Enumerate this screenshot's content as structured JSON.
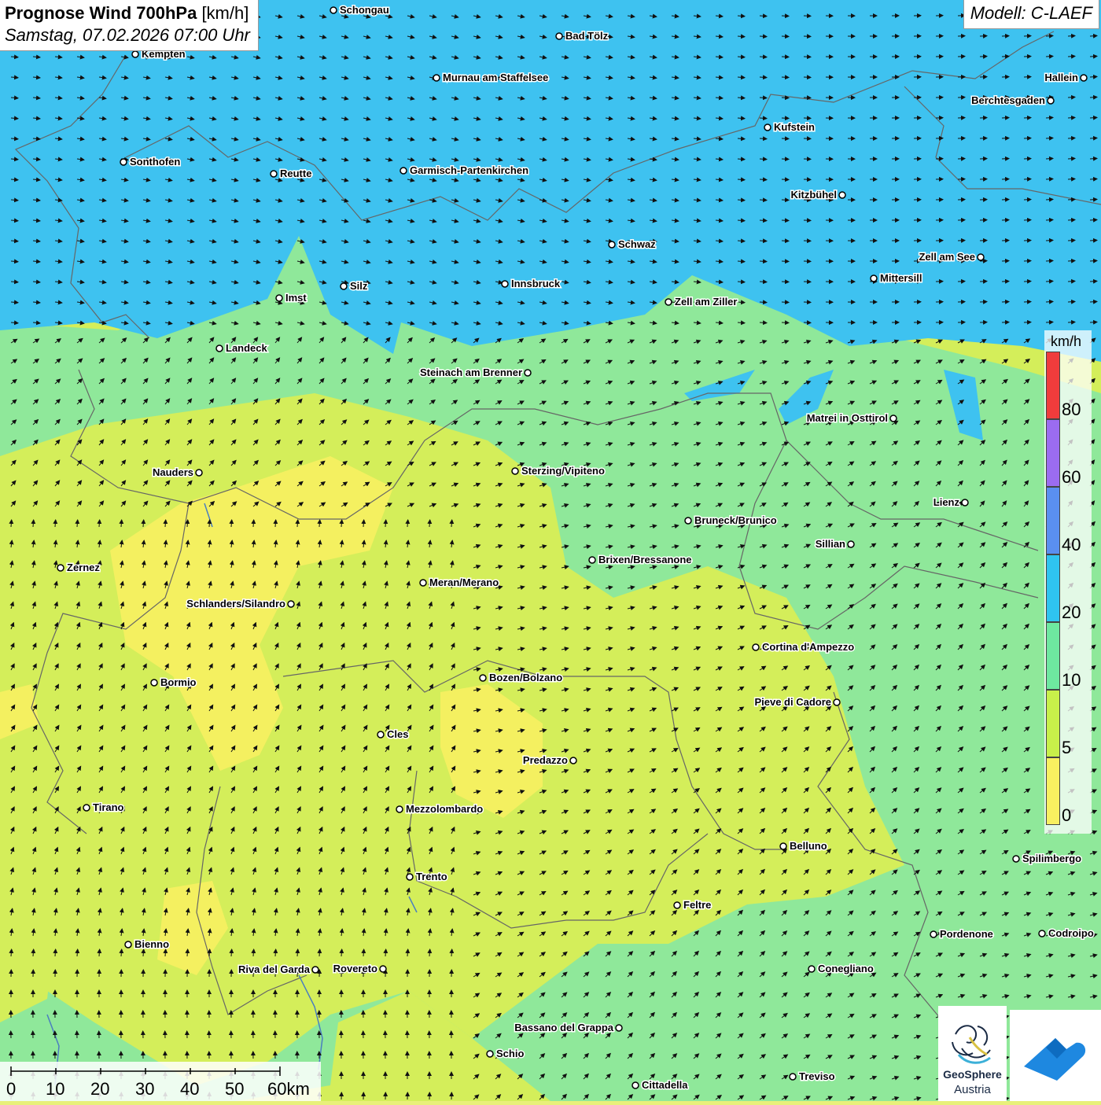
{
  "title": {
    "main": "Prognose Wind 700hPa",
    "unit": "[km/h]",
    "datetime": "Samstag, 07.02.2026 07:00 Uhr"
  },
  "model": "Modell: C-LAEF",
  "legend": {
    "unit": "km/h",
    "labels": [
      "80",
      "60",
      "40",
      "20",
      "10",
      "5",
      "0"
    ],
    "colors": {
      "above80": "#f2f2f2",
      "60-80": "#f03c3c",
      "40-60": "#9b6cf0",
      "20-40": "#5a8ff0",
      "10-20": "#2fc4f0",
      "5-10": "#6ee8a0",
      "0-5": "#c8f04a",
      "0": "#f8f060"
    }
  },
  "scale_bar": {
    "labels": [
      "0",
      "10",
      "20",
      "30",
      "40",
      "50",
      "60km"
    ]
  },
  "logo": {
    "name": "GeoSphere",
    "sub": "Austria"
  },
  "cities": [
    {
      "name": "Schongau",
      "side": "right"
    },
    {
      "name": "Bad Tölz",
      "side": "right"
    },
    {
      "name": "Kempten",
      "side": "right"
    },
    {
      "name": "Murnau am Staffelsee",
      "side": "right"
    },
    {
      "name": "Hallein",
      "side": "left"
    },
    {
      "name": "Berchtesgaden",
      "side": "left"
    },
    {
      "name": "Kufstein",
      "side": "right"
    },
    {
      "name": "Sonthofen",
      "side": "right"
    },
    {
      "name": "Reutte",
      "side": "right"
    },
    {
      "name": "Garmisch-Partenkirchen",
      "side": "right"
    },
    {
      "name": "Kitzbühel",
      "side": "left"
    },
    {
      "name": "Schwaz",
      "side": "right"
    },
    {
      "name": "Zell am See",
      "side": "left"
    },
    {
      "name": "Mittersill",
      "side": "right"
    },
    {
      "name": "Silz",
      "side": "right"
    },
    {
      "name": "Innsbruck",
      "side": "right"
    },
    {
      "name": "Imst",
      "side": "right"
    },
    {
      "name": "Zell am Ziller",
      "side": "right"
    },
    {
      "name": "Landeck",
      "side": "right"
    },
    {
      "name": "Steinach am Brenner",
      "side": "left"
    },
    {
      "name": "Matrei in Osttirol",
      "side": "left"
    },
    {
      "name": "Nauders",
      "side": "left"
    },
    {
      "name": "Sterzing/Vipiteno",
      "side": "right"
    },
    {
      "name": "Lienz",
      "side": "left"
    },
    {
      "name": "Bruneck/Brunico",
      "side": "right"
    },
    {
      "name": "Sillian",
      "side": "left"
    },
    {
      "name": "Zernez",
      "side": "right"
    },
    {
      "name": "Brixen/Bressanone",
      "side": "right"
    },
    {
      "name": "Meran/Merano",
      "side": "right"
    },
    {
      "name": "Schlanders/Silandro",
      "side": "left"
    },
    {
      "name": "Cortina d'Ampezzo",
      "side": "right"
    },
    {
      "name": "Bormio",
      "side": "right"
    },
    {
      "name": "Bozen/Bolzano",
      "side": "right"
    },
    {
      "name": "Pieve di Cadore",
      "side": "left"
    },
    {
      "name": "Cles",
      "side": "right"
    },
    {
      "name": "Predazzo",
      "side": "left"
    },
    {
      "name": "Tirano",
      "side": "right"
    },
    {
      "name": "Mezzolombardo",
      "side": "right"
    },
    {
      "name": "Belluno",
      "side": "right"
    },
    {
      "name": "Spilimbergo",
      "side": "right"
    },
    {
      "name": "Trento",
      "side": "right"
    },
    {
      "name": "Feltre",
      "side": "right"
    },
    {
      "name": "Pordenone",
      "side": "right"
    },
    {
      "name": "Codroipo",
      "side": "right"
    },
    {
      "name": "Bienno",
      "side": "right"
    },
    {
      "name": "Riva del Garda",
      "side": "left"
    },
    {
      "name": "Rovereto",
      "side": "left"
    },
    {
      "name": "Conegliano",
      "side": "right"
    },
    {
      "name": "Bassano del Grappa",
      "side": "left"
    },
    {
      "name": "Schio",
      "side": "right"
    },
    {
      "name": "Treviso",
      "side": "right"
    },
    {
      "name": "Cittadella",
      "side": "right"
    }
  ]
}
